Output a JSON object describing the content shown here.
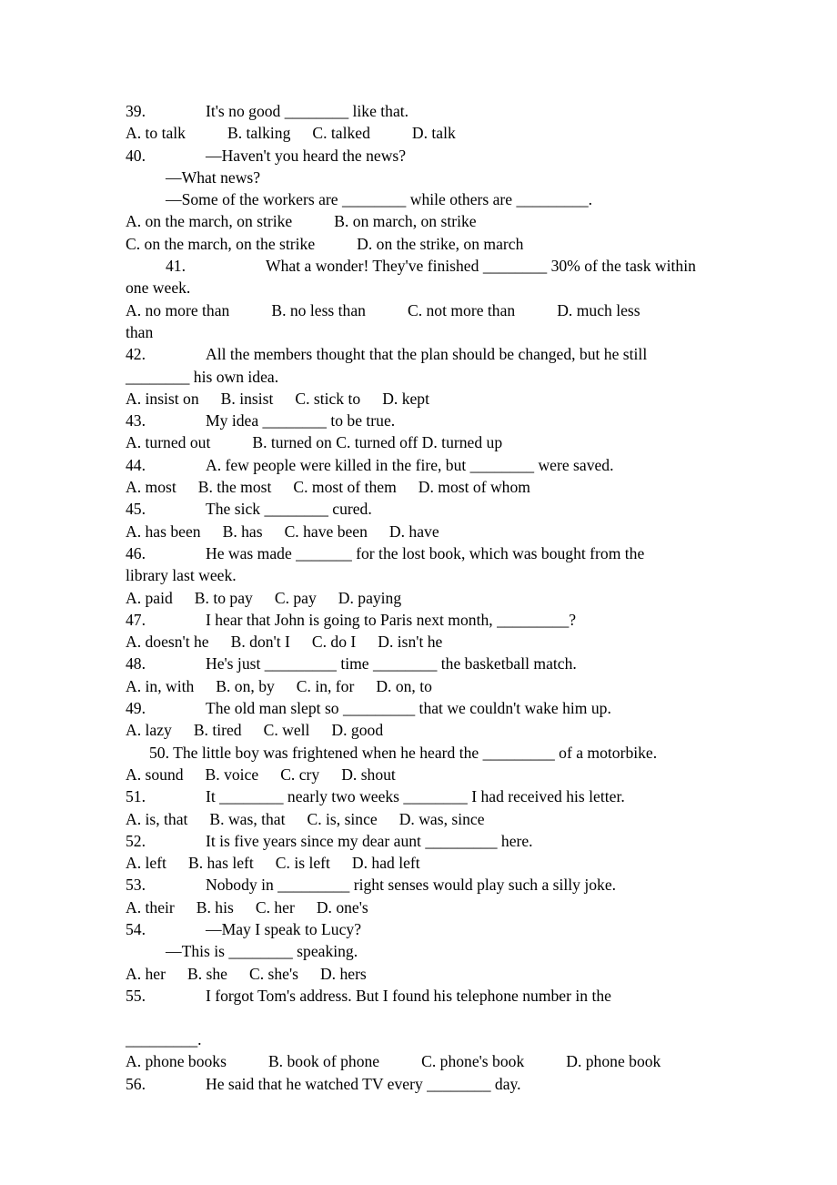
{
  "document": {
    "type": "english-grammar-multiple-choice-worksheet",
    "text_color": "#000000",
    "background_color": "#ffffff",
    "questions": [
      {
        "number": "39.",
        "stem_lines": [
          "It's no good ________ like that."
        ],
        "options_lines": [
          "A. to talk\tB. talking\tC. talked\tD. talk"
        ],
        "options": [
          "A. to talk",
          "B. talking",
          "C. talked",
          "D. talk"
        ]
      },
      {
        "number": "40.",
        "stem_lines": [
          "—Haven't you heard the news?",
          "—What news?",
          "—Some of the workers are ________ while others are _________."
        ],
        "options_lines": [
          "A. on the march, on strike\tB. on march, on strike",
          "C. on the march, on the strike\tD. on the strike, on march"
        ],
        "options": [
          "A. on the march, on strike",
          "B. on march, on strike",
          "C. on the march, on the strike",
          "D. on the strike, on march"
        ]
      },
      {
        "number": "41.",
        "stem_lines": [
          "What a wonder! They've finished ________ 30% of the task within",
          "one week."
        ],
        "options_lines": [
          "A. no more than\tB. no less than\tC. not more than\tD. much less",
          "than"
        ],
        "options": [
          "A. no more than",
          "B. no less than",
          "C. not more than",
          "D. much less than"
        ]
      },
      {
        "number": "42.",
        "stem_lines": [
          "All the members thought that the plan should be changed, but he still",
          "________ his own idea."
        ],
        "options_lines": [
          "A. insist on\tB. insist\tC. stick to\tD. kept"
        ],
        "options": [
          "A. insist on",
          "B. insist",
          "C. stick to",
          "D. kept"
        ]
      },
      {
        "number": "43.",
        "stem_lines": [
          "My idea ________ to be true."
        ],
        "options_lines": [
          "A. turned out\tB. turned on C. turned off D. turned up"
        ],
        "options": [
          "A. turned out",
          "B. turned on",
          "C. turned off",
          "D. turned up"
        ]
      },
      {
        "number": "44.",
        "stem_lines": [
          "A. few people were killed in the fire, but ________ were saved."
        ],
        "options_lines": [
          "A. most\tB. the most\tC. most of them\tD. most of whom"
        ],
        "options": [
          "A. most",
          "B. the most",
          "C. most of them",
          "D. most of whom"
        ]
      },
      {
        "number": "45.",
        "stem_lines": [
          "The sick ________ cured."
        ],
        "options_lines": [
          "A. has been\tB. has\tC. have been\tD. have"
        ],
        "options": [
          "A. has been",
          "B. has",
          "C. have been",
          "D. have"
        ]
      },
      {
        "number": "46.",
        "stem_lines": [
          "He was made _______ for the lost book, which was bought from the",
          "library last week."
        ],
        "options_lines": [
          "A. paid\tB. to pay\tC. pay\tD. paying"
        ],
        "options": [
          "A. paid",
          "B. to pay",
          "C. pay",
          "D. paying"
        ]
      },
      {
        "number": "47.",
        "stem_lines": [
          "I hear that John is going to Paris next month, _________?"
        ],
        "options_lines": [
          "A. doesn't he\tB. don't I\tC. do I\tD. isn't he"
        ],
        "options": [
          "A. doesn't he",
          "B. don't I",
          "C. do I",
          "D. isn't he"
        ]
      },
      {
        "number": "48.",
        "stem_lines": [
          "He's just _________ time ________ the basketball match."
        ],
        "options_lines": [
          "A. in, with\tB. on, by\tC. in, for\tD. on, to"
        ],
        "options": [
          "A. in, with",
          "B. on, by",
          "C. in, for",
          "D. on, to"
        ]
      },
      {
        "number": "49.",
        "stem_lines": [
          "The old man slept so _________ that we couldn't wake him up."
        ],
        "options_lines": [
          "A. lazy\tB. tired\tC. well\tD. good"
        ],
        "options": [
          "A. lazy",
          "B. tired",
          "C. well",
          "D. good"
        ]
      },
      {
        "number": "50.",
        "stem_lines": [
          "The little boy was frightened when he heard the _________ of a motorbike."
        ],
        "options_lines": [
          "A. sound\tB. voice\tC. cry\tD. shout"
        ],
        "options": [
          "A. sound",
          "B. voice",
          "C. cry",
          "D. shout"
        ]
      },
      {
        "number": "51.",
        "stem_lines": [
          "It ________ nearly two weeks ________ I had received his letter."
        ],
        "options_lines": [
          "A. is, that\tB. was, that\tC. is, since\tD. was, since"
        ],
        "options": [
          "A. is, that",
          "B. was, that",
          "C. is, since",
          "D. was, since"
        ]
      },
      {
        "number": "52.",
        "stem_lines": [
          "It is five years since my dear aunt _________ here."
        ],
        "options_lines": [
          "A. left\tB. has left\tC. is left\tD. had left"
        ],
        "options": [
          "A. left",
          "B. has left",
          "C. is left",
          "D. had left"
        ]
      },
      {
        "number": "53.",
        "stem_lines": [
          "Nobody in _________ right senses would play such a silly joke."
        ],
        "options_lines": [
          "A. their\tB. his\tC. her\tD. one's"
        ],
        "options": [
          "A. their",
          "B. his",
          "C. her",
          "D. one's"
        ]
      },
      {
        "number": "54.",
        "stem_lines": [
          "—May I speak to Lucy?",
          "—This is ________ speaking."
        ],
        "options_lines": [
          "A. her\tB. she\tC. she's\tD. hers"
        ],
        "options": [
          "A. her",
          "B. she",
          "C. she's",
          "D. hers"
        ]
      },
      {
        "number": "55.",
        "stem_lines": [
          "I forgot Tom's address. But I found his telephone number in the",
          "_________."
        ],
        "options_lines": [
          "A. phone books\tB. book of phone\tC. phone's book\tD. phone book"
        ],
        "options": [
          "A. phone books",
          "B. book of phone",
          "C. phone's book",
          "D. phone book"
        ]
      },
      {
        "number": "56.",
        "stem_lines": [
          "He said that he watched TV every ________ day."
        ],
        "options_lines": [],
        "options": []
      }
    ]
  },
  "lines": [
    {
      "id": "l01",
      "text": "39.",
      "tab": "tab-l",
      "rest": "It's no good ________ like that."
    },
    {
      "id": "l02",
      "text": "A. to talk",
      "t1": "tab-m",
      "b": "B. talking",
      "t2": "tab-s",
      "c": "C. talked",
      "t3": "tab-m",
      "d": "D. talk"
    },
    {
      "id": "l03",
      "text": "40.",
      "tab": "tab-l",
      "rest": "—Haven't you heard the news?"
    },
    {
      "id": "l04",
      "text": "—What news?"
    },
    {
      "id": "l05",
      "text": "—Some of the workers are ________ while others are _________."
    },
    {
      "id": "l06",
      "text": "A. on the march, on strike",
      "t1": "tab-m",
      "b": "B. on march, on strike"
    },
    {
      "id": "l07",
      "text": "C. on the march, on the strike",
      "t1": "tab-m",
      "b": "D. on the strike, on march"
    },
    {
      "id": "l08",
      "text": "41.",
      "tab": "tab-xl",
      "rest": "What a wonder! They've finished ________ 30% of the task within"
    },
    {
      "id": "l09",
      "text": "one week."
    },
    {
      "id": "l10",
      "text": "A. no more than",
      "t1": "tab-m",
      "b": "B. no less than",
      "t2": "tab-m",
      "c": "C. not more than",
      "t3": "tab-m",
      "d": "D. much less"
    },
    {
      "id": "l11",
      "text": "than"
    },
    {
      "id": "l12",
      "text": "42.",
      "tab": "tab-l",
      "rest": "All the members thought that the plan should be changed, but he still"
    },
    {
      "id": "l13",
      "text": "________ his own idea."
    },
    {
      "id": "l14",
      "text": "A. insist on",
      "t1": "tab-s",
      "b": "B. insist",
      "t2": "tab-s",
      "c": "C. stick to",
      "t3": "tab-s",
      "d": "D. kept"
    },
    {
      "id": "l15",
      "text": "43.",
      "tab": "tab-l",
      "rest": "My idea ________ to be true."
    },
    {
      "id": "l16",
      "text": "A. turned out",
      "t1": "tab-m",
      "b": "B. turned on C. turned off D. turned up"
    },
    {
      "id": "l17",
      "text": "44.",
      "tab": "tab-l",
      "rest": "A. few people were killed in the fire, but ________ were saved."
    },
    {
      "id": "l18",
      "text": "A. most",
      "t1": "tab-s",
      "b": "B. the most",
      "t2": "tab-s",
      "c": "C. most of them",
      "t3": "tab-s",
      "d": "D. most of whom"
    },
    {
      "id": "l19",
      "text": "45.",
      "tab": "tab-l",
      "rest": "The sick ________ cured."
    },
    {
      "id": "l20",
      "text": "A. has been",
      "t1": "tab-s",
      "b": "B. has",
      "t2": "tab-s",
      "c": "C. have been",
      "t3": "tab-s",
      "d": "D. have"
    },
    {
      "id": "l21",
      "text": "46.",
      "tab": "tab-l",
      "rest": "He was made _______ for the lost book, which was bought from the"
    },
    {
      "id": "l22",
      "text": "library last week."
    },
    {
      "id": "l23",
      "text": "A. paid",
      "t1": "tab-s",
      "b": "B. to pay",
      "t2": "tab-s",
      "c": "C. pay",
      "t3": "tab-s",
      "d": "D. paying"
    },
    {
      "id": "l24",
      "text": "47.",
      "tab": "tab-l",
      "rest": "I hear that John is going to Paris next month, _________?"
    },
    {
      "id": "l25",
      "text": "A. doesn't he",
      "t1": "tab-s",
      "b": "B. don't I",
      "t2": "tab-s",
      "c": "C. do I",
      "t3": "tab-s",
      "d": "D. isn't he"
    },
    {
      "id": "l26",
      "text": "48.",
      "tab": "tab-l",
      "rest": "He's just _________ time ________ the basketball match."
    },
    {
      "id": "l27",
      "text": "A. in, with",
      "t1": "tab-s",
      "b": "B. on, by",
      "t2": "tab-s",
      "c": "C. in, for",
      "t3": "tab-s",
      "d": "D. on, to"
    },
    {
      "id": "l28",
      "text": "49.",
      "tab": "tab-l",
      "rest": "The old man slept so _________ that we couldn't wake him up."
    },
    {
      "id": "l29",
      "text": "A. lazy",
      "t1": "tab-s",
      "b": "B. tired",
      "t2": "tab-s",
      "c": "C. well",
      "t3": "tab-s",
      "d": "D. good"
    },
    {
      "id": "l30",
      "text": "50. The little boy was frightened when he heard the _________ of a motorbike."
    },
    {
      "id": "l31",
      "text": "A. sound",
      "t1": "tab-s",
      "b": "B. voice",
      "t2": "tab-s",
      "c": "C. cry",
      "t3": "tab-s",
      "d": "D. shout"
    },
    {
      "id": "l32",
      "text": "51.",
      "tab": "tab-l",
      "rest": "It ________ nearly two weeks ________ I had received his letter."
    },
    {
      "id": "l33",
      "text": "A. is, that",
      "t1": "tab-s",
      "b": "B. was, that",
      "t2": "tab-s",
      "c": "C. is, since",
      "t3": "tab-s",
      "d": "D. was, since"
    },
    {
      "id": "l34",
      "text": "52.",
      "tab": "tab-l",
      "rest": "It is five years since my dear aunt _________ here."
    },
    {
      "id": "l35",
      "text": "A. left",
      "t1": "tab-s",
      "b": "B. has left",
      "t2": "tab-s",
      "c": "C. is left",
      "t3": "tab-s",
      "d": "D. had left"
    },
    {
      "id": "l36",
      "text": "53.",
      "tab": "tab-l",
      "rest": "Nobody in _________ right senses would play such a silly joke."
    },
    {
      "id": "l37",
      "text": "A. their",
      "t1": "tab-s",
      "b": "B. his",
      "t2": "tab-s",
      "c": "C. her",
      "t3": "tab-s",
      "d": "D. one's"
    },
    {
      "id": "l38",
      "text": "54.",
      "tab": "tab-l",
      "rest": "—May I speak to Lucy?"
    },
    {
      "id": "l39",
      "text": "—This is ________ speaking."
    },
    {
      "id": "l40",
      "text": "A. her",
      "t1": "tab-s",
      "b": "B. she",
      "t2": "tab-s",
      "c": "C. she's",
      "t3": "tab-s",
      "d": "D. hers"
    },
    {
      "id": "l41",
      "text": "55.",
      "tab": "tab-l",
      "rest": "I forgot Tom's address. But I found his telephone number in the"
    },
    {
      "id": "l42",
      "text": "_________."
    },
    {
      "id": "l43",
      "text": "A. phone books",
      "t1": "tab-m",
      "b": "B. book of phone",
      "t2": "tab-m",
      "c": "C. phone's book",
      "t3": "tab-m",
      "d": "D. phone book"
    },
    {
      "id": "l44",
      "text": "56.",
      "tab": "tab-l",
      "rest": "He said that he watched TV every ________ day."
    }
  ]
}
